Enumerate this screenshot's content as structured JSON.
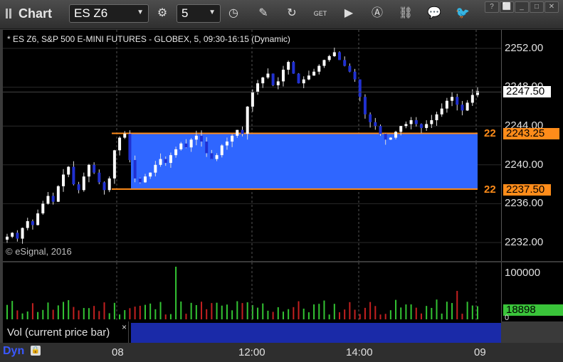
{
  "toolbar": {
    "title": "Chart",
    "symbol": "ES Z6",
    "interval": "5"
  },
  "chart": {
    "title": "* ES Z6, S&P 500 E-MINI FUTURES - GLOBEX, 5, 09:30-16:15 (Dynamic)",
    "copyright": "© eSignal, 2016",
    "price_labels": [
      "2252.00",
      "2248.00",
      "2244.00",
      "2240.00",
      "2236.00",
      "2232.00"
    ],
    "current_price": "2247.50",
    "level_high_label": "2243.25",
    "level_low_label": "2237.50",
    "level_tag": "22",
    "colors": {
      "up": "#ffffff",
      "down": "#2030d0",
      "zone": "#2f66ff",
      "level": "#ff8c1a",
      "last": "#ffffff"
    }
  },
  "volume": {
    "axis_label": "100000",
    "current_value": "18898",
    "zero_label": "0",
    "study_label": "Vol (current price bar)",
    "close_glyph": "×"
  },
  "time_axis": {
    "labels": [
      "08",
      "12:00",
      "14:00",
      "09"
    ],
    "mode_label": "Dyn"
  }
}
